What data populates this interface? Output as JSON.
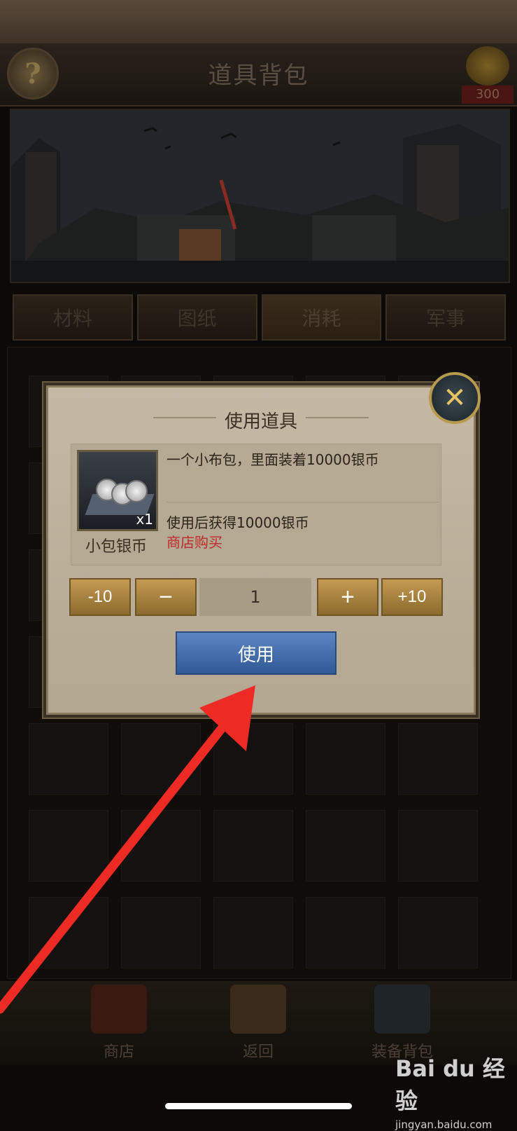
{
  "header": {
    "title": "道具背包",
    "help_symbol": "?",
    "reward_count": "300"
  },
  "tabs": [
    {
      "label": "材料"
    },
    {
      "label": "图纸"
    },
    {
      "label": "消耗",
      "active": true
    },
    {
      "label": "军事"
    }
  ],
  "modal": {
    "title": "使用道具",
    "item": {
      "name": "小包银币",
      "quantity": "x1",
      "description": "一个小布包，里面装着10000银币",
      "effect": "使用后获得10000银币",
      "shop_link": "商店购买"
    },
    "quantity_controls": {
      "minus10": "-10",
      "minus": "−",
      "value": "1",
      "plus": "+",
      "plus10": "+10"
    },
    "use_button": "使用",
    "close_symbol": "✕"
  },
  "bottom_nav": [
    {
      "label": "商店",
      "icon": "shop-icon"
    },
    {
      "label": "返回",
      "icon": "gate-icon"
    },
    {
      "label": "装备背包",
      "icon": "equipment-chest-icon"
    }
  ],
  "watermark": {
    "logo": "Bai du 经验",
    "url": "jingyan.baidu.com"
  },
  "colors": {
    "accent_gold": "#c49a52",
    "use_button_blue": "#2f5a96",
    "link_red": "#c0282a",
    "arrow_red": "#ee2a24"
  }
}
